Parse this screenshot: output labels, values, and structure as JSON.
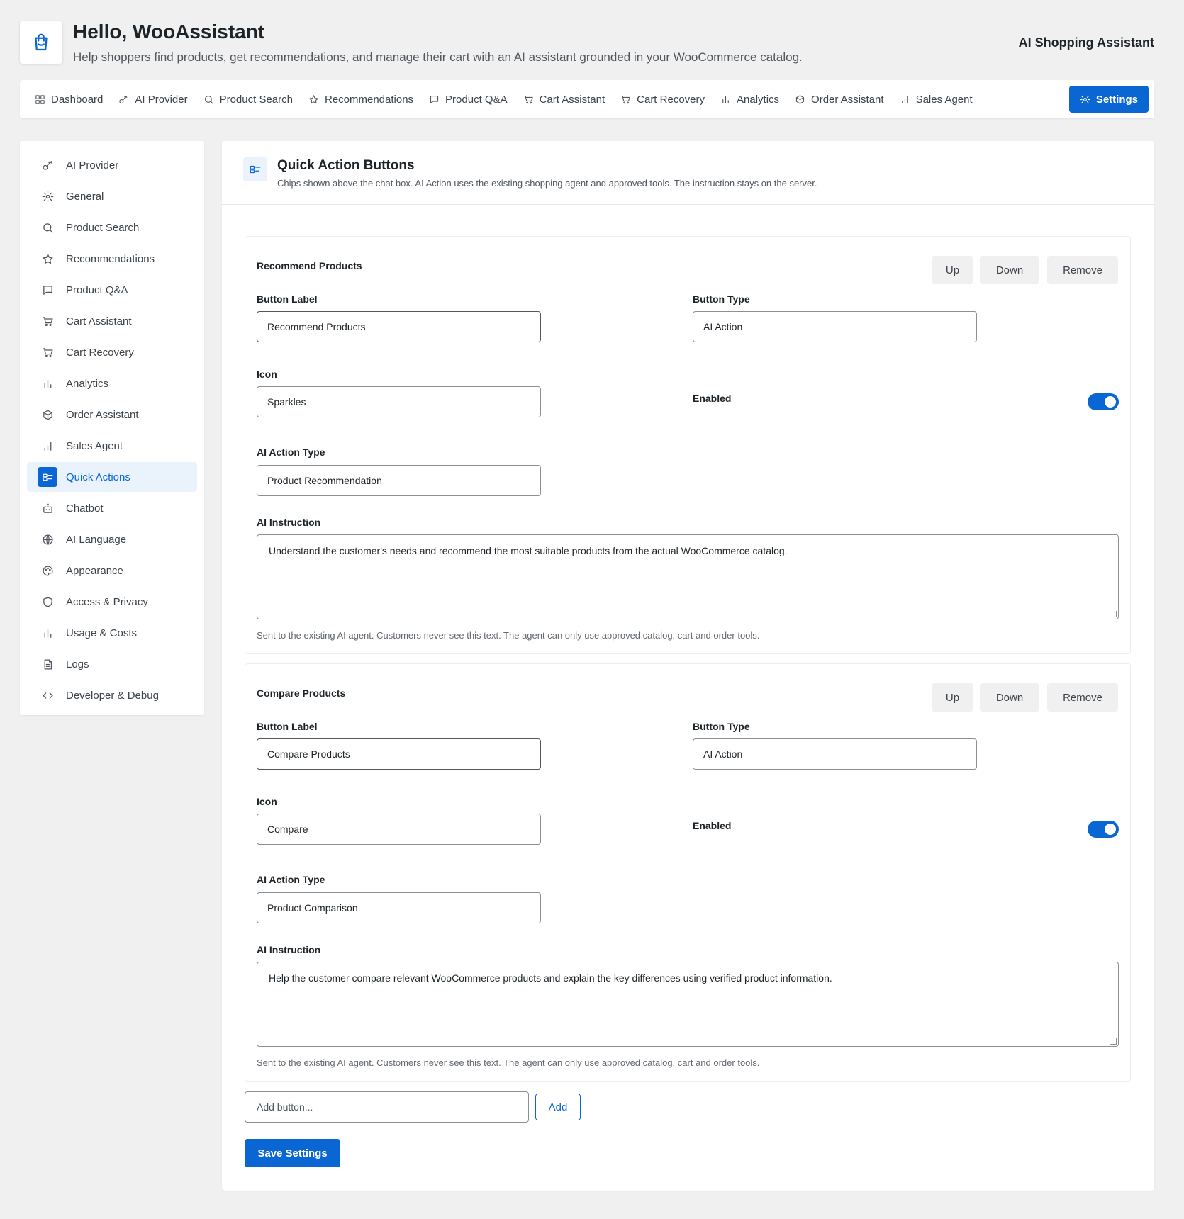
{
  "header": {
    "title": "Hello, WooAssistant",
    "subtitle": "Help shoppers find products, get recommendations, and manage their cart with an AI assistant grounded in your WooCommerce catalog.",
    "right_label": "AI Shopping Assistant",
    "logo_icon": "shopping-bag-icon"
  },
  "topnav": {
    "items": [
      {
        "label": "Dashboard",
        "icon": "grid-icon"
      },
      {
        "label": "AI Provider",
        "icon": "key-icon"
      },
      {
        "label": "Product Search",
        "icon": "search-icon"
      },
      {
        "label": "Recommendations",
        "icon": "star-icon"
      },
      {
        "label": "Product Q&A",
        "icon": "chat-icon"
      },
      {
        "label": "Cart Assistant",
        "icon": "cart-icon"
      },
      {
        "label": "Cart Recovery",
        "icon": "cart-icon"
      },
      {
        "label": "Analytics",
        "icon": "bar-chart-icon"
      },
      {
        "label": "Order Assistant",
        "icon": "package-icon"
      },
      {
        "label": "Sales Agent",
        "icon": "bar-chart-icon"
      },
      {
        "label": "Settings",
        "icon": "gear-icon",
        "active": true
      }
    ]
  },
  "sidebar": {
    "items": [
      {
        "label": "AI Provider",
        "icon": "key-icon"
      },
      {
        "label": "General",
        "icon": "gear-icon"
      },
      {
        "label": "Product Search",
        "icon": "search-icon"
      },
      {
        "label": "Recommendations",
        "icon": "star-icon"
      },
      {
        "label": "Product Q&A",
        "icon": "chat-icon"
      },
      {
        "label": "Cart Assistant",
        "icon": "cart-icon"
      },
      {
        "label": "Cart Recovery",
        "icon": "cart-icon"
      },
      {
        "label": "Analytics",
        "icon": "bar-chart-icon"
      },
      {
        "label": "Order Assistant",
        "icon": "package-icon"
      },
      {
        "label": "Sales Agent",
        "icon": "bar-chart-icon"
      },
      {
        "label": "Quick Actions",
        "icon": "quick-actions-icon",
        "active": true
      },
      {
        "label": "Chatbot",
        "icon": "bot-icon"
      },
      {
        "label": "AI Language",
        "icon": "globe-icon"
      },
      {
        "label": "Appearance",
        "icon": "palette-icon"
      },
      {
        "label": "Access & Privacy",
        "icon": "shield-icon"
      },
      {
        "label": "Usage & Costs",
        "icon": "bar-chart-icon"
      },
      {
        "label": "Logs",
        "icon": "document-icon"
      },
      {
        "label": "Developer & Debug",
        "icon": "code-icon"
      }
    ]
  },
  "main": {
    "title": "Quick Action Buttons",
    "description": "Chips shown above the chat box. AI Action uses the existing shopping agent and approved tools. The instruction stays on the server.",
    "labels": {
      "button_label": "Button Label",
      "button_type": "Button Type",
      "icon": "Icon",
      "enabled": "Enabled",
      "ai_action_type": "AI Action Type",
      "ai_instruction": "AI Instruction",
      "up": "Up",
      "down": "Down",
      "remove": "Remove",
      "hint": "Sent to the existing AI agent. Customers never see this text. The agent can only use approved catalog, cart and order tools."
    },
    "buttons": [
      {
        "name": "Recommend Products",
        "label_value": "Recommend Products",
        "type_value": "AI Action",
        "icon_value": "Sparkles",
        "enabled": true,
        "action_type_value": "Product Recommendation",
        "instruction": "Understand the customer's needs and recommend the most suitable products from the actual WooCommerce catalog."
      },
      {
        "name": "Compare Products",
        "label_value": "Compare Products",
        "type_value": "AI Action",
        "icon_value": "Compare",
        "enabled": true,
        "action_type_value": "Product Comparison",
        "instruction": "Help the customer compare relevant WooCommerce products and explain the key differences using verified product information."
      }
    ],
    "add_placeholder": "Add button...",
    "add_label": "Add",
    "save_label": "Save Settings"
  },
  "colors": {
    "accent": "#0a66d2",
    "background": "#f0f0f1",
    "active_bg": "#eaf2fc"
  }
}
